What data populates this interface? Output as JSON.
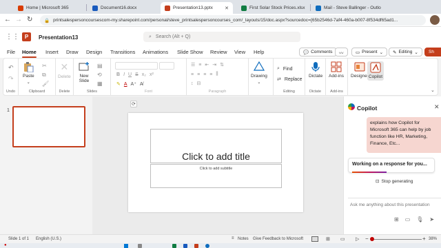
{
  "browser": {
    "tabs": [
      {
        "label": "Home | Microsoft 365",
        "color": "#d83b01"
      },
      {
        "label": "Document16.docx",
        "color": "#185abd"
      },
      {
        "label": "Presentation13.pptx",
        "color": "#c43e1c",
        "active": true
      },
      {
        "label": "First Solar Stock Prices.xlsx",
        "color": "#107c41"
      },
      {
        "label": "Mail - Steve Ballinger - Outlo",
        "color": "#0f6cbd"
      }
    ],
    "url": "printsalespersoncoursescom-my.sharepoint.com/personal/steve_printsalespersoncourses_com/_layouts/15/doc.aspx?sourcedoc={65b2546d-7af4-460a-b007-8f534df65ad1..."
  },
  "office": {
    "doc_title": "Presentation13",
    "search_placeholder": "Search (Alt + Q)"
  },
  "ribbon": {
    "tabs": [
      "File",
      "Home",
      "Insert",
      "Draw",
      "Design",
      "Transitions",
      "Animations",
      "Slide Show",
      "Review",
      "View",
      "Help"
    ],
    "active_tab": "Home",
    "right_buttons": {
      "comments": "Comments",
      "present": "Present",
      "editing": "Editing",
      "share": "Sh"
    },
    "groups": {
      "undo": "Undo",
      "clipboard": "Clipboard",
      "paste": "Paste",
      "delete_group": "Delete",
      "delete": "Delete",
      "slides": "Slides",
      "new_slide": "New Slide",
      "font": "Font",
      "paragraph": "Paragraph",
      "drawing": "Drawing",
      "editing": "Editing",
      "find": "Find",
      "replace": "Replace",
      "dictate_group": "Dictate",
      "dictate": "Dictate",
      "addins_group": "Add-ins",
      "addins": "Add-ins",
      "designer": "Designer",
      "copilot": "Copilot"
    }
  },
  "thumbnails": {
    "number": "1"
  },
  "slide": {
    "title_placeholder": "Click to add title",
    "subtitle_placeholder": "Click to add subtitle"
  },
  "copilot": {
    "title": "Copilot",
    "message": "explains how Copilot for Microsoft 365 can help by job function like HR, Marketing, Finance, Etc...",
    "working": "Working on a response for you...",
    "stop": "Stop generating",
    "input_placeholder": "Ask me anything about this presentation"
  },
  "status": {
    "slide_of": "Slide 1 of 1",
    "language": "English (U.S.)",
    "notes": "Notes",
    "feedback": "Give Feedback to Microsoft",
    "zoom": "38%"
  }
}
